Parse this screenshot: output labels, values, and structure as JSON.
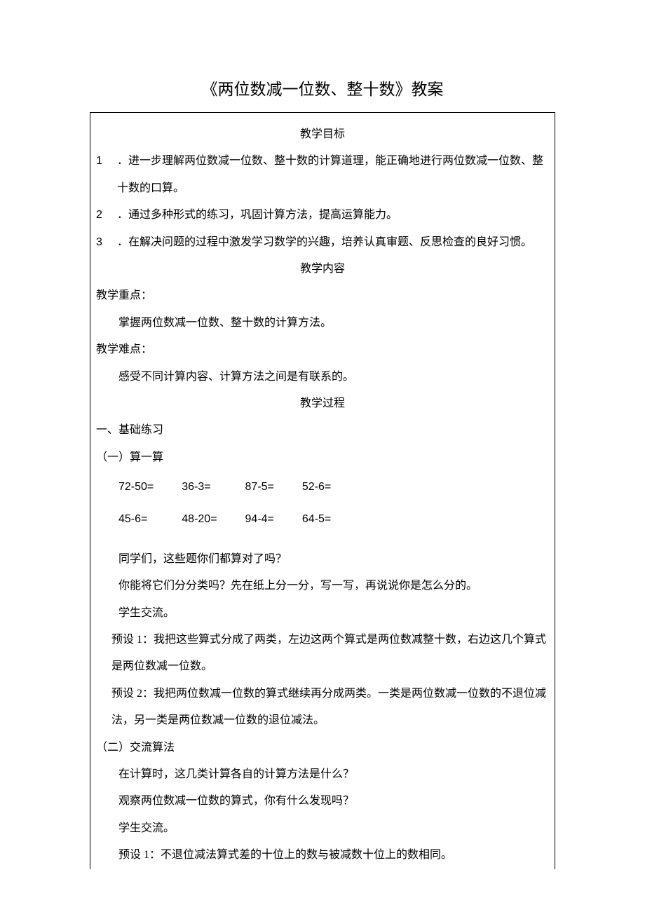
{
  "title": "《两位数减一位数、整十数》教案",
  "headings": {
    "goals": "教学目标",
    "content": "教学内容",
    "process": "教学过程"
  },
  "goals": [
    {
      "num": "1",
      "text": "．进一步理解两位数减一位数、整十数的计算道理，能正确地进行两位数减一位数、整十数的口算。"
    },
    {
      "num": "2",
      "text": "．通过多种形式的练习，巩固计算方法，提高运算能力。"
    },
    {
      "num": "3",
      "text": "．在解决问题的过程中激发学习数学的兴趣，培养认真审题、反思检查的良好习惯。"
    }
  ],
  "focus_label": "教学重点：",
  "focus_text": "掌握两位数减一位数、整十数的计算方法。",
  "difficulty_label": "教学难点：",
  "difficulty_text": "感受不同计算内容、计算方法之间是有联系的。",
  "section1": "一、基础练习",
  "sub1": "（一）算一算",
  "eq": {
    "r1c1": "72-50=",
    "r1c2": "36-3=",
    "r1c3": "87-5=",
    "r1c4": "52-6=",
    "r2c1": "45-6=",
    "r2c2": "48-20=",
    "r2c3": "94-4=",
    "r2c4": "64-5="
  },
  "q1": "同学们，这些题你们都算对了吗？",
  "q2": "你能将它们分分类吗？先在纸上分一分，写一写，再说说你是怎么分的。",
  "q3": "学生交流。",
  "pre1": "预设 1：我把这些算式分成了两类，左边这两个算式是两位数减整十数，右边这几个算式是两位数减一位数。",
  "pre2": "预设 2：我把两位数减一位数的算式继续再分成两类。一类是两位数减一位数的不退位减法，另一类是两位数减一位数的退位减法。",
  "sub2": "（二）交流算法",
  "m1": "在计算时，这几类计算各自的计算方法是什么？",
  "m2": "观察两位数减一位数的算式，你有什么发现吗？",
  "m3": "学生交流。",
  "m4": "预设 1：不退位减法算式差的十位上的数与被减数十位上的数相同。"
}
